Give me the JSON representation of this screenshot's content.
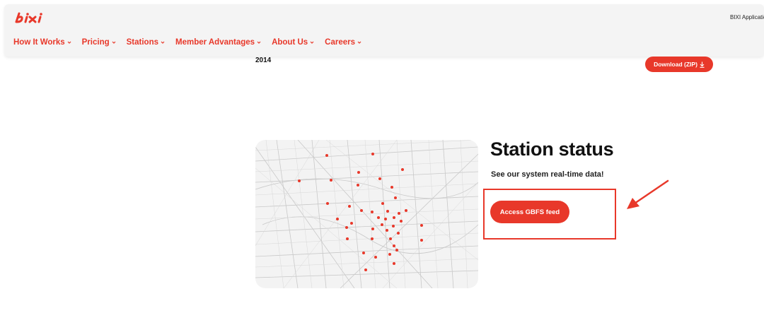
{
  "header": {
    "logo_text": "BIXI",
    "app_link": "BIXI Application",
    "nav": [
      {
        "label": "How It Works"
      },
      {
        "label": "Pricing"
      },
      {
        "label": "Stations"
      },
      {
        "label": "Member Advantages"
      },
      {
        "label": "About Us"
      },
      {
        "label": "Careers"
      }
    ]
  },
  "content": {
    "year": "2014",
    "download_label": "Download (ZIP)",
    "section_title": "Station status",
    "section_subtitle": "See our system real-time data!",
    "gbfs_button": "Access GBFS feed"
  },
  "colors": {
    "accent": "#e8382a"
  },
  "icons": {
    "download": "download-icon",
    "chevron": "chevron-down-icon",
    "arrow": "pointer-arrow-icon"
  }
}
